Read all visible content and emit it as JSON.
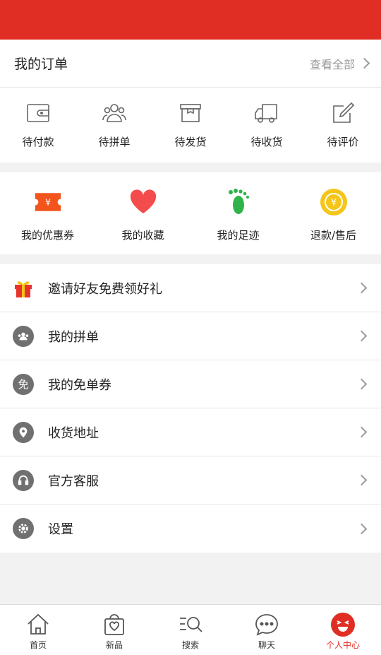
{
  "header": {
    "color": "#e02e24"
  },
  "orders": {
    "title": "我的订单",
    "view_all": "查看全部",
    "items": [
      {
        "label": "待付款",
        "icon": "wallet-icon"
      },
      {
        "label": "待拼单",
        "icon": "group-users-icon"
      },
      {
        "label": "待发货",
        "icon": "package-box-icon"
      },
      {
        "label": "待收货",
        "icon": "delivery-truck-icon"
      },
      {
        "label": "待评价",
        "icon": "edit-review-icon"
      }
    ]
  },
  "quick": {
    "items": [
      {
        "label": "我的优惠券",
        "icon": "coupon-icon",
        "color": "#f2541b"
      },
      {
        "label": "我的收藏",
        "icon": "heart-icon",
        "color": "#f44c4c"
      },
      {
        "label": "我的足迹",
        "icon": "footprint-icon",
        "color": "#2fb34a"
      },
      {
        "label": "退款/售后",
        "icon": "refund-coin-icon",
        "color": "#f5c518"
      }
    ]
  },
  "menu": {
    "items": [
      {
        "label": "邀请好友免费领好礼",
        "icon": "gift-icon"
      },
      {
        "label": "我的拼单",
        "icon": "group-icon"
      },
      {
        "label": "我的免单券",
        "icon": "free-coupon-icon",
        "icon_text": "免"
      },
      {
        "label": "收货地址",
        "icon": "location-pin-icon"
      },
      {
        "label": "官方客服",
        "icon": "headset-icon"
      },
      {
        "label": "设置",
        "icon": "gear-icon"
      }
    ]
  },
  "tabbar": {
    "items": [
      {
        "label": "首页",
        "icon": "home-icon"
      },
      {
        "label": "新品",
        "icon": "shopping-bag-icon"
      },
      {
        "label": "搜索",
        "icon": "search-icon"
      },
      {
        "label": "聊天",
        "icon": "chat-icon"
      },
      {
        "label": "个人中心",
        "icon": "profile-face-icon",
        "active": true
      }
    ],
    "active_color": "#e02e24"
  }
}
